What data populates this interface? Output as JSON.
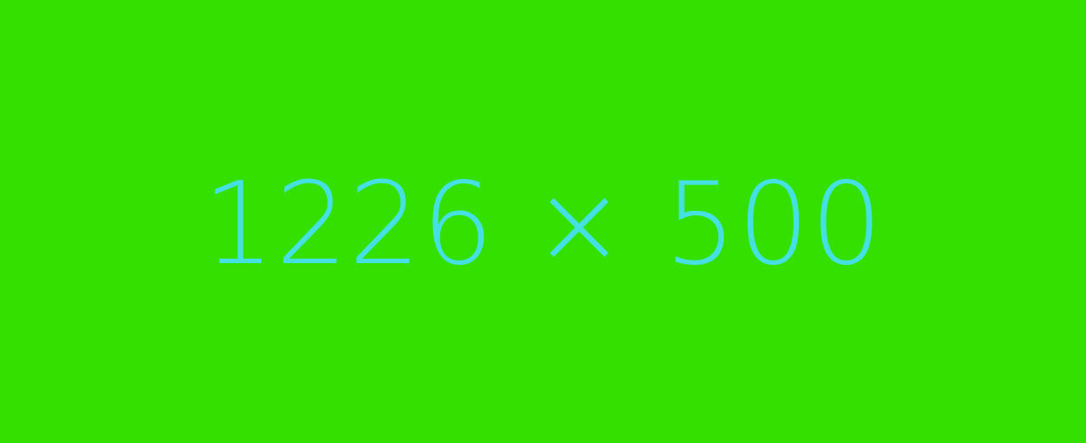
{
  "placeholder": {
    "text": "1226 × 500",
    "background_color": "#34E000",
    "text_color": "#44E0E2"
  }
}
